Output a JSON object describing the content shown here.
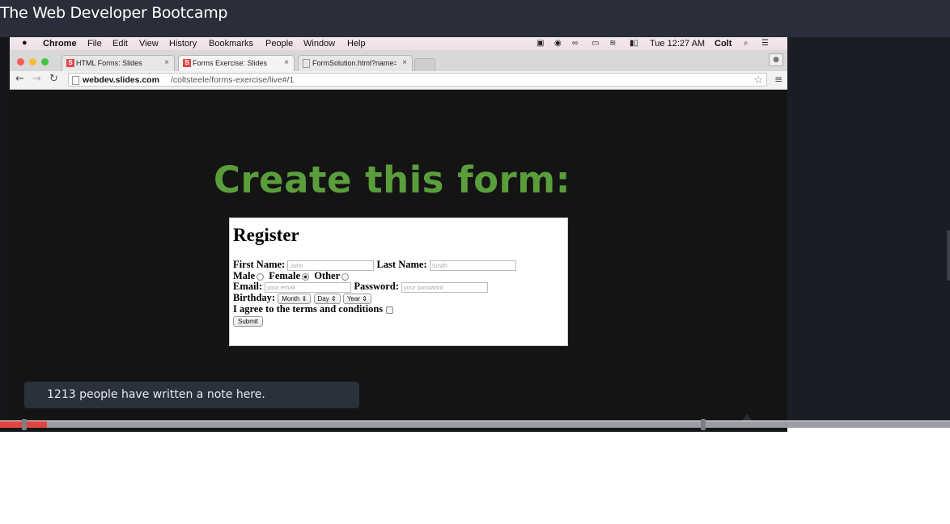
{
  "course_title": "The Web Developer Bootcamp",
  "mac_menubar": {
    "items": [
      "Chrome",
      "File",
      "Edit",
      "View",
      "History",
      "Bookmarks",
      "People",
      "Window",
      "Help"
    ],
    "clock": "Tue 12:27 AM",
    "user": "Colt"
  },
  "browser": {
    "tabs": [
      {
        "favicon": "S",
        "title": "HTML Forms: Slides",
        "active": false
      },
      {
        "favicon": "S",
        "title": "Forms Exercise: Slides",
        "active": true
      },
      {
        "favicon": "",
        "title": "FormSolution.html?name=",
        "active": false
      }
    ],
    "url_host": "webdev.slides.com",
    "url_path": "/coltsteele/forms-exercise/live#/1"
  },
  "slide": {
    "heading": "Create this form:",
    "form": {
      "title": "Register",
      "first_name_label": "First Name:",
      "first_name_placeholder": "John",
      "last_name_label": "Last Name:",
      "last_name_placeholder": "Smith",
      "gender_options": [
        "Male",
        "Female",
        "Other"
      ],
      "gender_selected": "Female",
      "email_label": "Email:",
      "email_placeholder": "your email",
      "password_label": "Password:",
      "password_placeholder": "your password",
      "birthday_label": "Birthday:",
      "birthday_selects": [
        "Month",
        "Day",
        "Year"
      ],
      "terms_label": "I agree to the terms and conditions",
      "submit_label": "Submit"
    }
  },
  "note_bubble": {
    "text": "1213 people have written a note here."
  },
  "player": {
    "progress_fraction": 0.049,
    "played_color": "#e0453f"
  },
  "colors": {
    "heading_green": "#5a9e3c",
    "topbar": "#2a2e3a"
  }
}
